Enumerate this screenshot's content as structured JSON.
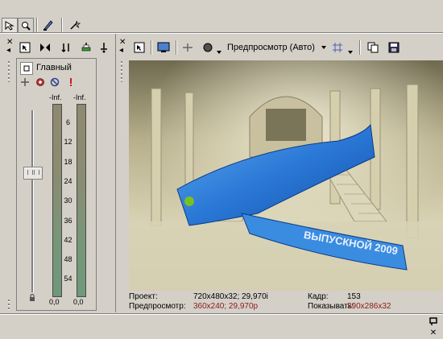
{
  "top_toolbar": {
    "icons": [
      "selection-tool-icon",
      "zoom-tool-icon",
      "envelope-edit-icon",
      "magic-tool-icon"
    ]
  },
  "mixer": {
    "toolbar_icons": [
      "insert-bus-icon",
      "downmix-icon",
      "dim-icon",
      "master-fx-icon",
      "monitor-icon"
    ],
    "bus_label": "Главный",
    "meter_peak_left": "-Inf.",
    "meter_peak_right": "-Inf.",
    "scale": [
      "6",
      "12",
      "18",
      "24",
      "30",
      "36",
      "42",
      "48",
      "54"
    ],
    "fader_value_left": "0,0",
    "fader_value_right": "0,0"
  },
  "preview": {
    "toolbar": {
      "preview_quality_label": "Предпросмотр (Авто)"
    },
    "info": {
      "project_label": "Проект:",
      "project_value": "720x480x32; 29,970i",
      "preview_label": "Предпросмотр:",
      "preview_value": "360x240; 29,970p",
      "frame_label": "Кадр:",
      "frame_value": "153",
      "display_label": "Показывать:",
      "display_value": "390x286x32"
    },
    "ribbon_text": "ВЫПУСКНОЙ 2009",
    "colors": {
      "ribbon": "#2a78d6",
      "value_red": "#8b1a1a"
    }
  }
}
